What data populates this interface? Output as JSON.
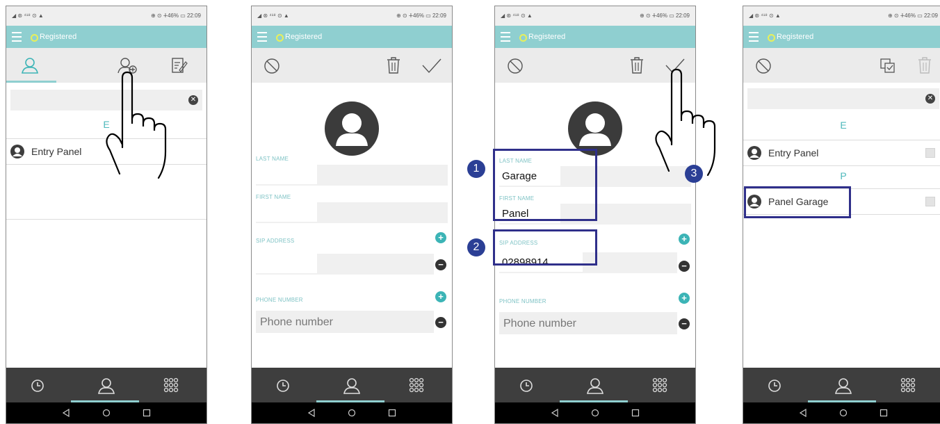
{
  "status": {
    "left": "◢ ⊛ ⁴¹⁸ ⊙ ▲",
    "right": "⊕ ⊙ ⵜ46% ▭ 22:09"
  },
  "app": {
    "registered": "Registered"
  },
  "screen1": {
    "section_letter": "E",
    "contacts": [
      {
        "name": "Entry Panel"
      }
    ]
  },
  "form": {
    "last_name_label": "LAST NAME",
    "first_name_label": "FIRST NAME",
    "sip_label": "SIP ADDRESS",
    "phone_label": "PHONE NUMBER",
    "phone_placeholder": "Phone number"
  },
  "screen3": {
    "last_name_value": "Garage",
    "first_name_value": "Panel",
    "sip_value": "02898914",
    "badges": [
      "1",
      "2",
      "3"
    ]
  },
  "screen4": {
    "section_e": "E",
    "section_p": "P",
    "contacts": [
      {
        "name": "Entry Panel"
      },
      {
        "name": "Panel Garage"
      }
    ]
  },
  "icons": {
    "contacts": "person-outline-icon",
    "add_contact": "person-add-icon",
    "edit": "edit-list-icon",
    "cancel": "cancel-circle-icon",
    "delete": "trash-icon",
    "confirm": "checkmark-icon",
    "select_all": "select-all-icon",
    "history": "clock-icon",
    "dialpad": "dialpad-icon"
  },
  "colors": {
    "teal": "#8fcfd0",
    "accent": "#3cb4b6",
    "highlight": "#2f2f8a",
    "badge": "#2b3f95"
  }
}
